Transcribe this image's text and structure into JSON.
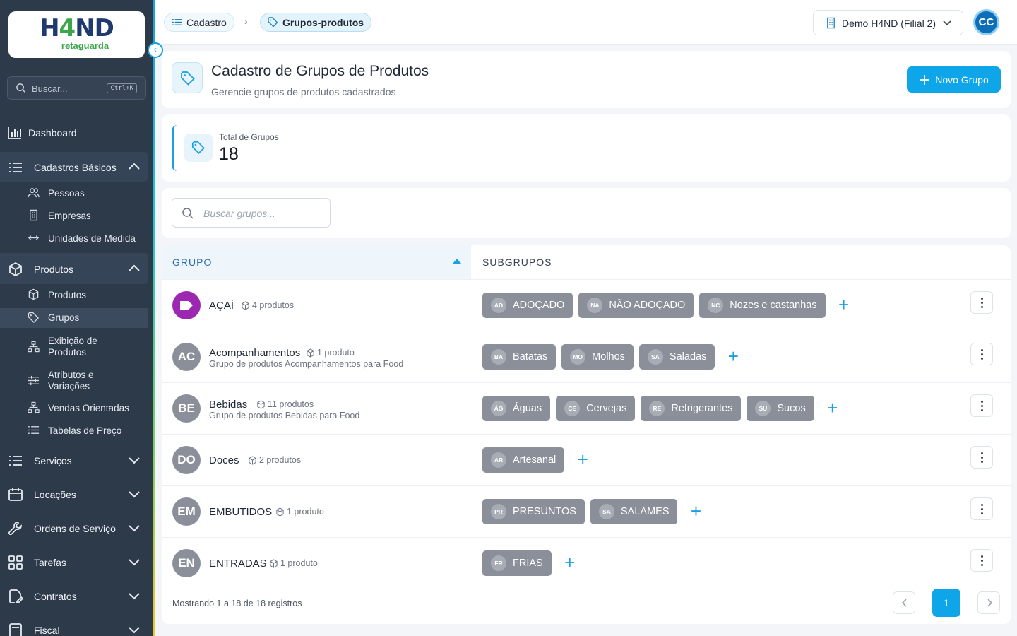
{
  "logo": {
    "main_a": "H",
    "main_b": "4",
    "main_c": "ND",
    "sub": "retaguarda"
  },
  "sidebar": {
    "search_placeholder": "Buscar...",
    "search_shortcut": "Ctrl+K",
    "dashboard": "Dashboard",
    "cadastros": {
      "label": "Cadastros Básicos",
      "items": [
        "Pessoas",
        "Empresas",
        "Unidades de Medida"
      ]
    },
    "produtos": {
      "label": "Produtos",
      "items": [
        "Produtos",
        "Grupos",
        "Exibição de Produtos",
        "Atributos e Variações",
        "Vendas Orientadas",
        "Tabelas de Preço"
      ]
    },
    "sections": [
      "Serviços",
      "Locações",
      "Ordens de Serviço",
      "Tarefas",
      "Contratos",
      "Fiscal"
    ]
  },
  "topbar": {
    "crumb1": "Cadastro",
    "crumb2": "Grupos-produtos",
    "branch": "Demo H4ND (Filial 2)",
    "avatar": "CC"
  },
  "header": {
    "title": "Cadastro de Grupos de Produtos",
    "subtitle": "Gerencie grupos de produtos cadastrados",
    "new_button": "Novo Grupo"
  },
  "stats": {
    "label": "Total de Grupos",
    "value": "18"
  },
  "search": {
    "placeholder": "Buscar grupos..."
  },
  "table": {
    "col_group": "GRUPO",
    "col_subgroups": "SUBGRUPOS",
    "rows": [
      {
        "abbr": "",
        "name": "AÇAÍ",
        "count": "4 produtos",
        "desc": "",
        "color": "#9c27b0",
        "subgroups": [
          {
            "abbr": "AD",
            "name": "ADOÇADO"
          },
          {
            "abbr": "NA",
            "name": "NÃO ADOÇADO"
          },
          {
            "abbr": "NC",
            "name": "Nozes e castanhas"
          }
        ]
      },
      {
        "abbr": "AC",
        "name": "Acompanhamentos",
        "count": "1 produto",
        "desc": "Grupo de produtos Acompanhamentos para Food",
        "color": "#8a8f9a",
        "subgroups": [
          {
            "abbr": "BA",
            "name": "Batatas"
          },
          {
            "abbr": "MO",
            "name": "Molhos"
          },
          {
            "abbr": "SA",
            "name": "Saladas"
          }
        ]
      },
      {
        "abbr": "BE",
        "name": "Bebidas",
        "count": "11 produtos",
        "desc": "Grupo de produtos Bebidas para Food",
        "color": "#8a8f9a",
        "subgroups": [
          {
            "abbr": "ÁG",
            "name": "Águas"
          },
          {
            "abbr": "CE",
            "name": "Cervejas"
          },
          {
            "abbr": "RE",
            "name": "Refrigerantes"
          },
          {
            "abbr": "SU",
            "name": "Sucos"
          }
        ]
      },
      {
        "abbr": "DO",
        "name": "Doces",
        "count": "2 produtos",
        "desc": "",
        "color": "#8a8f9a",
        "subgroups": [
          {
            "abbr": "AR",
            "name": "Artesanal"
          }
        ]
      },
      {
        "abbr": "EM",
        "name": "EMBUTIDOS",
        "count": "1 produto",
        "desc": "",
        "color": "#8a8f9a",
        "subgroups": [
          {
            "abbr": "PR",
            "name": "PRESUNTOS"
          },
          {
            "abbr": "SA",
            "name": "SALAMES"
          }
        ]
      },
      {
        "abbr": "EN",
        "name": "ENTRADAS",
        "count": "1 produto",
        "desc": "",
        "color": "#8a8f9a",
        "subgroups": [
          {
            "abbr": "FR",
            "name": "FRIAS"
          }
        ]
      }
    ]
  },
  "pagination": {
    "info": "Mostrando 1 a 18 de 18 registros",
    "current": "1"
  },
  "colors": {
    "accent": "#0ea5e9",
    "sidebar": "#2d3a4a",
    "chip": "#8a8f9a"
  }
}
